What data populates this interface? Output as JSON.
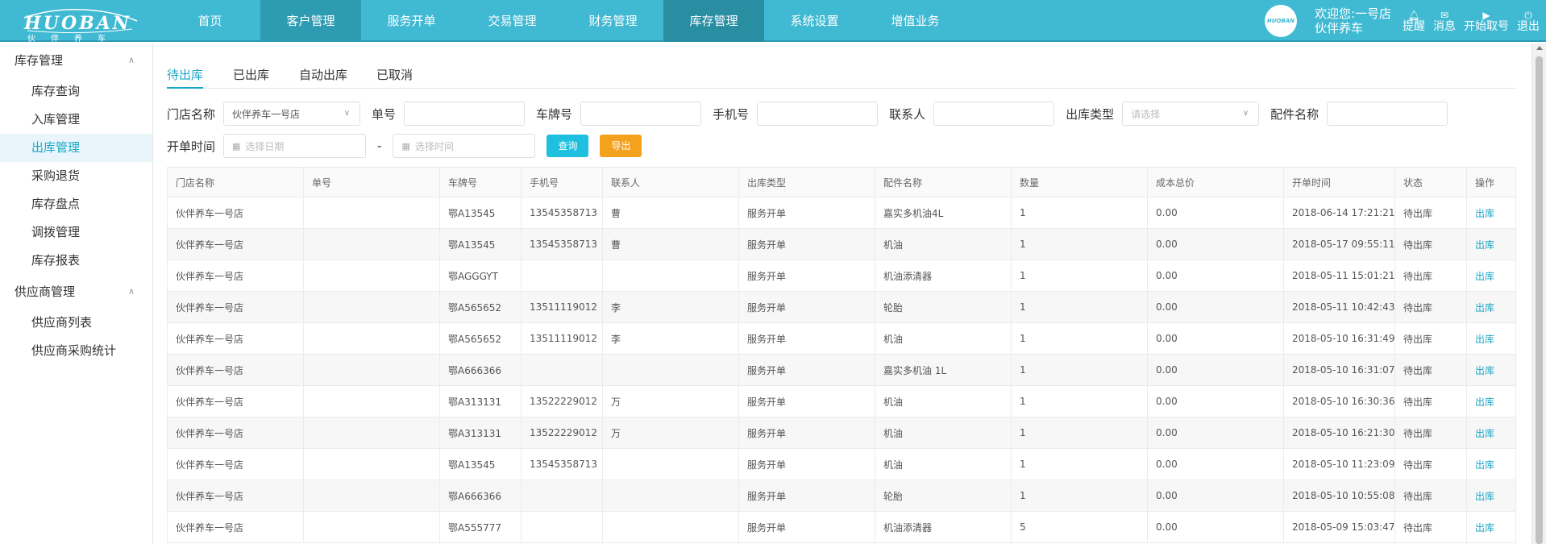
{
  "brand": {
    "logo_main": "HUOBAN",
    "logo_sub": "伙伴养车",
    "avatar_text": "HUOBAN"
  },
  "nav": {
    "items": [
      {
        "label": "首页"
      },
      {
        "label": "客户管理"
      },
      {
        "label": "服务开单"
      },
      {
        "label": "交易管理"
      },
      {
        "label": "财务管理"
      },
      {
        "label": "库存管理"
      },
      {
        "label": "系统设置"
      },
      {
        "label": "增值业务"
      }
    ],
    "active_index": 5
  },
  "user": {
    "welcome_line1": "欢迎您:一号店",
    "welcome_line2": "伙伴养车"
  },
  "tools": [
    {
      "label": "提醒",
      "icon": "bell-icon"
    },
    {
      "label": "消息",
      "icon": "mail-icon"
    },
    {
      "label": "开始取号",
      "icon": "play-icon"
    },
    {
      "label": "退出",
      "icon": "power-icon"
    }
  ],
  "sidebar": {
    "groups": [
      {
        "label": "库存管理",
        "items": [
          "库存查询",
          "入库管理",
          "出库管理",
          "采购退货",
          "库存盘点",
          "调拨管理",
          "库存报表"
        ]
      },
      {
        "label": "供应商管理",
        "items": [
          "供应商列表",
          "供应商采购统计"
        ]
      }
    ],
    "active_item": "出库管理"
  },
  "tabs": [
    "待出库",
    "已出库",
    "自动出库",
    "已取消"
  ],
  "filters": {
    "store_label": "门店名称",
    "store_value": "伙伴养车一号店",
    "order_label": "单号",
    "order_value": "",
    "plate_label": "车牌号",
    "plate_value": "",
    "phone_label": "手机号",
    "phone_value": "",
    "contact_label": "联系人",
    "contact_value": "",
    "type_label": "出库类型",
    "type_placeholder": "请选择",
    "part_label": "配件名称",
    "part_value": "",
    "time_label": "开单时间",
    "date_placeholder": "选择日期",
    "time_separator": "-",
    "time_placeholder": "选择时间",
    "query_button": "查询",
    "export_button": "导出"
  },
  "table": {
    "columns": [
      "门店名称",
      "单号",
      "车牌号",
      "手机号",
      "联系人",
      "出库类型",
      "配件名称",
      "数量",
      "成本总价",
      "开单时间",
      "状态",
      "操作"
    ],
    "rows": [
      [
        "伙伴养车一号店",
        "",
        "鄂A13545",
        "13545358713",
        "曹",
        "服务开单",
        "嘉实多机油4L",
        "1",
        "0.00",
        "2018-06-14 17:21:21",
        "待出库",
        "出库"
      ],
      [
        "伙伴养车一号店",
        "",
        "鄂A13545",
        "13545358713",
        "曹",
        "服务开单",
        "机油",
        "1",
        "0.00",
        "2018-05-17 09:55:11",
        "待出库",
        "出库"
      ],
      [
        "伙伴养车一号店",
        "",
        "鄂AGGGYT",
        "",
        "",
        "服务开单",
        "机油添清器",
        "1",
        "0.00",
        "2018-05-11 15:01:21",
        "待出库",
        "出库"
      ],
      [
        "伙伴养车一号店",
        "",
        "鄂A565652",
        "13511119012",
        "李",
        "服务开单",
        "轮胎",
        "1",
        "0.00",
        "2018-05-11 10:42:43",
        "待出库",
        "出库"
      ],
      [
        "伙伴养车一号店",
        "",
        "鄂A565652",
        "13511119012",
        "李",
        "服务开单",
        "机油",
        "1",
        "0.00",
        "2018-05-10 16:31:49",
        "待出库",
        "出库"
      ],
      [
        "伙伴养车一号店",
        "",
        "鄂A666366",
        "",
        "",
        "服务开单",
        "嘉实多机油 1L",
        "1",
        "0.00",
        "2018-05-10 16:31:07",
        "待出库",
        "出库"
      ],
      [
        "伙伴养车一号店",
        "",
        "鄂A313131",
        "13522229012",
        "万",
        "服务开单",
        "机油",
        "1",
        "0.00",
        "2018-05-10 16:30:36",
        "待出库",
        "出库"
      ],
      [
        "伙伴养车一号店",
        "",
        "鄂A313131",
        "13522229012",
        "万",
        "服务开单",
        "机油",
        "1",
        "0.00",
        "2018-05-10 16:21:30",
        "待出库",
        "出库"
      ],
      [
        "伙伴养车一号店",
        "",
        "鄂A13545",
        "13545358713",
        "",
        "服务开单",
        "机油",
        "1",
        "0.00",
        "2018-05-10 11:23:09",
        "待出库",
        "出库"
      ],
      [
        "伙伴养车一号店",
        "",
        "鄂A666366",
        "",
        "",
        "服务开单",
        "轮胎",
        "1",
        "0.00",
        "2018-05-10 10:55:08",
        "待出库",
        "出库"
      ],
      [
        "伙伴养车一号店",
        "",
        "鄂A555777",
        "",
        "",
        "服务开单",
        "机油添清器",
        "5",
        "0.00",
        "2018-05-09 15:03:47",
        "待出库",
        "出库"
      ]
    ]
  },
  "colors": {
    "header_bg": "#40b9d3",
    "nav_active": "#2a8ea3",
    "accent": "#1aa6c6",
    "export": "#f4a21d"
  }
}
